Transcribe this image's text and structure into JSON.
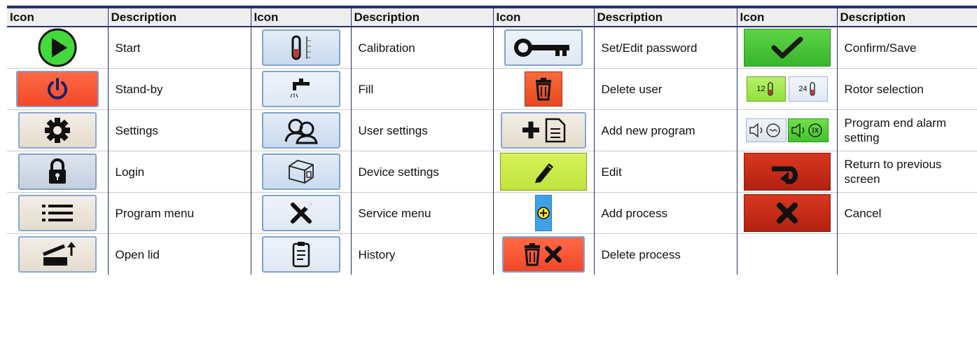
{
  "headers": [
    "Icon",
    "Description",
    "Icon",
    "Description",
    "Icon",
    "Description",
    "Icon",
    "Description"
  ],
  "rows": [
    [
      {
        "icon": "start-play-icon",
        "desc": "Start"
      },
      {
        "icon": "calibration-icon",
        "desc": "Calibration"
      },
      {
        "icon": "key-icon",
        "desc": "Set/Edit password"
      },
      {
        "icon": "checkmark-icon",
        "desc": "Confirm/Save"
      }
    ],
    [
      {
        "icon": "power-icon",
        "desc": "Stand-by"
      },
      {
        "icon": "faucet-icon",
        "desc": "Fill"
      },
      {
        "icon": "trash-icon",
        "desc": "Delete user"
      },
      {
        "icon": "rotor-selection-icon",
        "desc": "Rotor selection",
        "rotor_labels": [
          "12",
          "24"
        ]
      }
    ],
    [
      {
        "icon": "gear-icon",
        "desc": "Settings"
      },
      {
        "icon": "users-icon",
        "desc": "User settings"
      },
      {
        "icon": "add-document-icon",
        "desc": "Add new program"
      },
      {
        "icon": "alarm-setting-icon",
        "desc": "Program end alarm setting"
      }
    ],
    [
      {
        "icon": "lock-icon",
        "desc": "Login"
      },
      {
        "icon": "device-icon",
        "desc": "Device settings"
      },
      {
        "icon": "pencil-icon",
        "desc": "Edit"
      },
      {
        "icon": "return-arrow-icon",
        "desc": "Return to previous screen"
      }
    ],
    [
      {
        "icon": "list-menu-icon",
        "desc": "Program menu"
      },
      {
        "icon": "wrench-screwdriver-icon",
        "desc": "Service menu"
      },
      {
        "icon": "plus-circle-icon",
        "desc": "Add process"
      },
      {
        "icon": "x-icon",
        "desc": "Cancel"
      }
    ],
    [
      {
        "icon": "open-lid-icon",
        "desc": "Open lid"
      },
      {
        "icon": "clipboard-icon",
        "desc": "History"
      },
      {
        "icon": "trash-x-icon",
        "desc": "Delete process"
      },
      {
        "icon": "",
        "desc": ""
      }
    ]
  ],
  "colors": {
    "header_rule": "#27316e",
    "start_green": "#43d93a",
    "standby_orange": "#f4572f",
    "confirm_green": "#3fbf32",
    "cancel_red": "#c92a18",
    "edit_lime": "#c8ea45",
    "add_process_blue": "#3ea1e6"
  }
}
